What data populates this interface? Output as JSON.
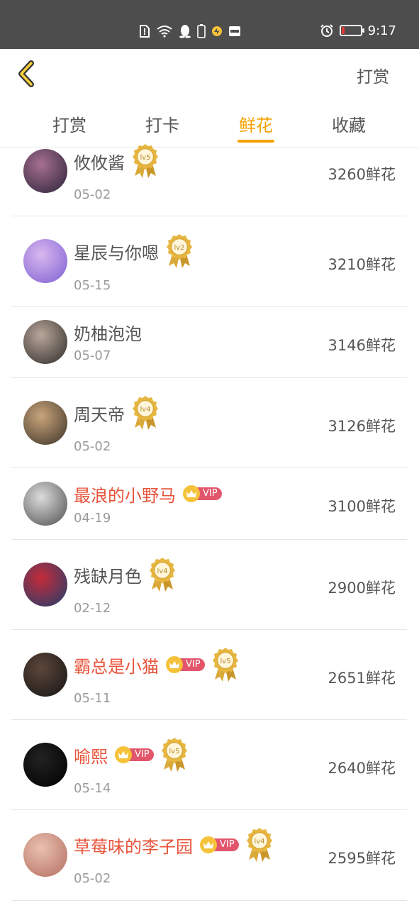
{
  "status_bar": {
    "time": "9:17",
    "battery_level": 0.15
  },
  "header": {
    "back_icon": "chevron-left-icon",
    "action_label": "打赏"
  },
  "tabs": [
    {
      "label": "打赏",
      "active": false
    },
    {
      "label": "打卡",
      "active": false
    },
    {
      "label": "鲜花",
      "active": true
    },
    {
      "label": "收藏",
      "active": false
    }
  ],
  "colors": {
    "accent": "#f5a200",
    "vip_name": "#e8533a",
    "vip_badge": "#e2566b",
    "level_badge": "#e6b640"
  },
  "list": [
    {
      "name": "攸攸酱",
      "vip": false,
      "level": "lv5",
      "date": "05-02",
      "amount": "3260鲜花"
    },
    {
      "name": "星辰与你嗯",
      "vip": false,
      "level": "lv2",
      "date": "05-15",
      "amount": "3210鲜花"
    },
    {
      "name": "奶柚泡泡",
      "vip": false,
      "level": "",
      "date": "05-07",
      "amount": "3146鲜花"
    },
    {
      "name": "周天帝",
      "vip": false,
      "level": "lv4",
      "date": "05-02",
      "amount": "3126鲜花"
    },
    {
      "name": "最浪的小野马",
      "vip": true,
      "vip_label": "VIP",
      "level": "",
      "date": "04-19",
      "amount": "3100鲜花"
    },
    {
      "name": "残缺月色",
      "vip": false,
      "level": "lv4",
      "date": "02-12",
      "amount": "2900鲜花"
    },
    {
      "name": "霸总是小猫",
      "vip": true,
      "vip_label": "VIP",
      "level": "lv5",
      "date": "05-11",
      "amount": "2651鲜花"
    },
    {
      "name": "喻熙",
      "vip": true,
      "vip_label": "VIP",
      "level": "lv5",
      "date": "05-14",
      "amount": "2640鲜花"
    },
    {
      "name": "草莓味的李子园",
      "vip": true,
      "vip_label": "VIP",
      "level": "lv4",
      "date": "05-02",
      "amount": "2595鲜花"
    }
  ]
}
